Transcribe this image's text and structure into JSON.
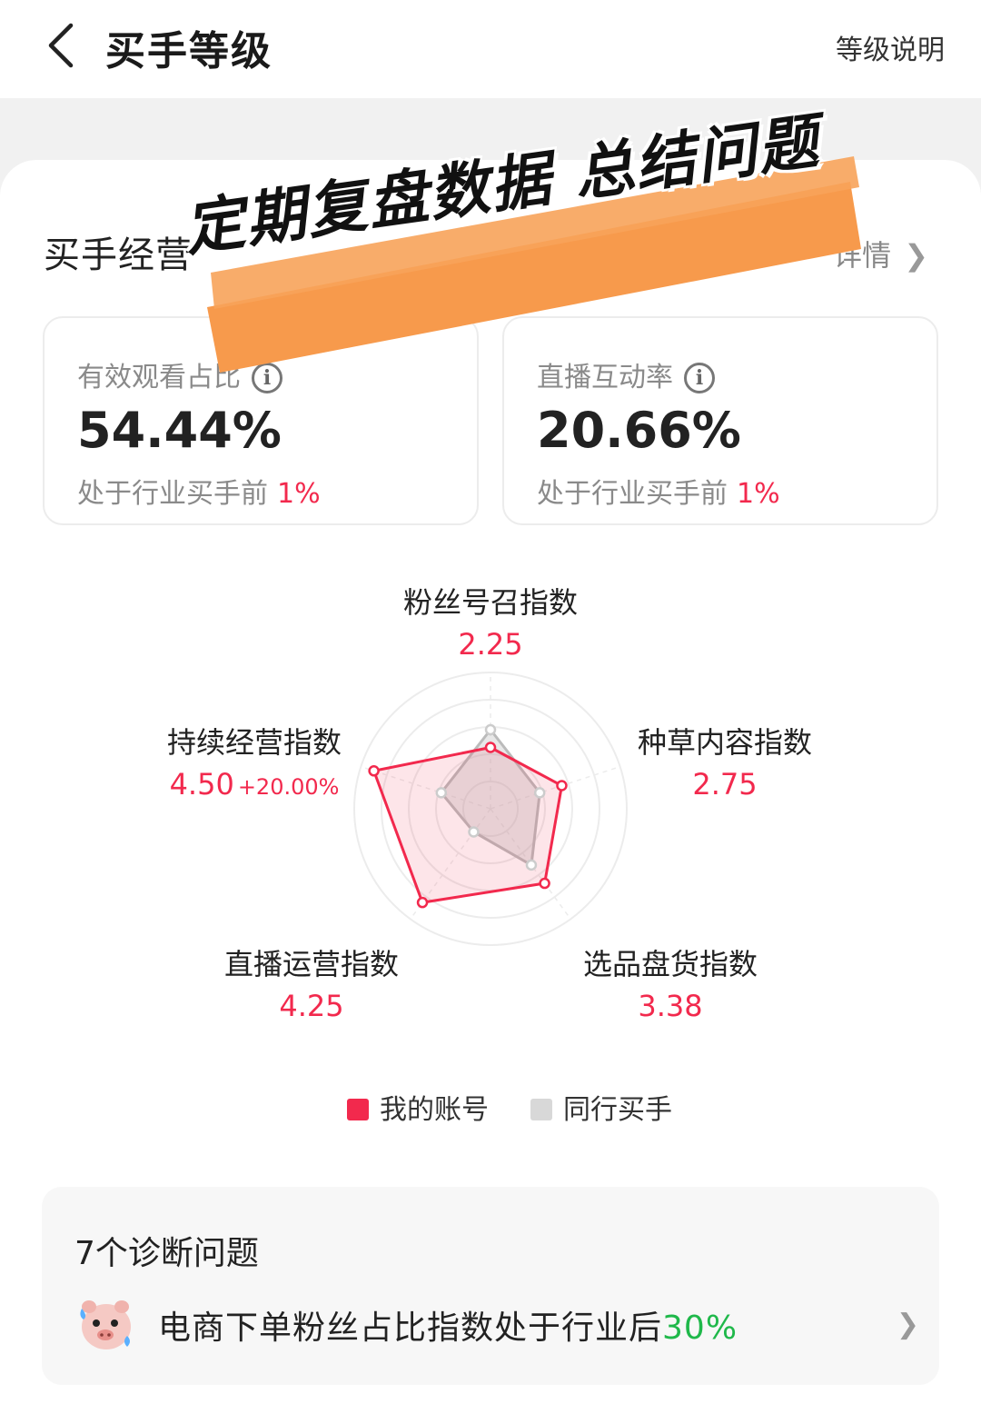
{
  "header": {
    "title": "买手等级",
    "level_desc": "等级说明"
  },
  "section": {
    "title": "买手经营",
    "detail_link": "详情"
  },
  "metrics": [
    {
      "label": "有效观看占比",
      "value": "54.44%",
      "rank_prefix": "处于行业买手前",
      "rank_value": "1%"
    },
    {
      "label": "直播互动率",
      "value": "20.66%",
      "rank_prefix": "处于行业买手前",
      "rank_value": "1%"
    }
  ],
  "radar": {
    "axes": [
      {
        "label": "粉丝号召指数",
        "value": "2.25"
      },
      {
        "label": "种草内容指数",
        "value": "2.75"
      },
      {
        "label": "选品盘货指数",
        "value": "3.38"
      },
      {
        "label": "直播运营指数",
        "value": "4.25"
      },
      {
        "label": "持续经营指数",
        "value": "4.50",
        "delta": "+20.00%"
      }
    ],
    "max": 5,
    "my_account": [
      2.25,
      2.75,
      3.38,
      4.25,
      4.5
    ],
    "peers": [
      2.9,
      1.9,
      2.55,
      1.05,
      1.9
    ],
    "colors": {
      "mine": "#f2294d",
      "peers": "#bbbbbb"
    }
  },
  "legend": {
    "mine": "我的账号",
    "peers": "同行买手"
  },
  "diagnosis": {
    "title": "7个诊断问题",
    "item_text": "电商下单粉丝占比指数处于行业后",
    "item_highlight": "30%",
    "item_icon": "pig-mascot-icon"
  },
  "overlay": {
    "text": "定期复盘数据  总结问题",
    "brush_color": "#f79a4c"
  }
}
